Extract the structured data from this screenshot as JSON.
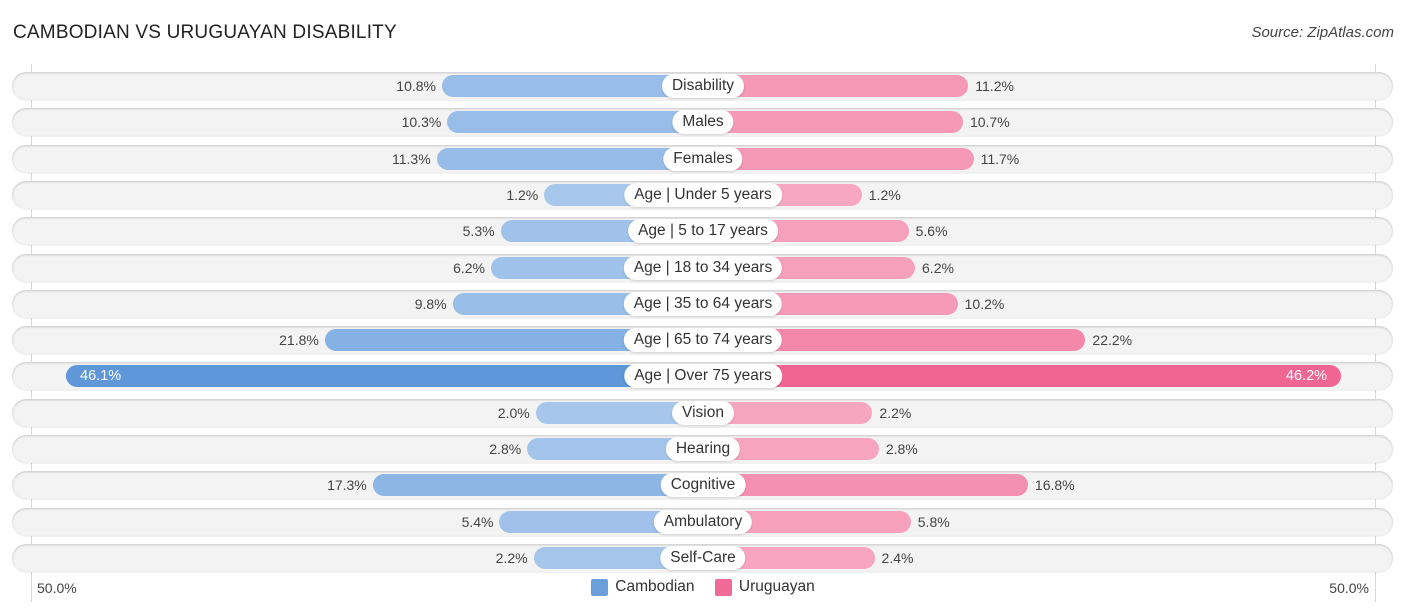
{
  "header": {
    "title": "CAMBODIAN VS URUGUAYAN DISABILITY",
    "source": "Source: ZipAtlas.com"
  },
  "axis": {
    "left_label": "50.0%",
    "right_label": "50.0%"
  },
  "legend": {
    "items": [
      {
        "label": "Cambodian",
        "color": "#6a9fdc"
      },
      {
        "label": "Uruguayan",
        "color": "#f06a96"
      }
    ]
  },
  "colors": {
    "left_light": "#a9c8ec",
    "left_dark": "#5e98da",
    "right_light": "#f7a9c2",
    "right_dark": "#f06592"
  },
  "chart_data": {
    "type": "bar",
    "orientation": "horizontal-diverging",
    "title": "CAMBODIAN VS URUGUAYAN DISABILITY",
    "xlim": [
      0,
      50
    ],
    "unit": "%",
    "categories": [
      "Disability",
      "Males",
      "Females",
      "Age | Under 5 years",
      "Age | 5 to 17 years",
      "Age | 18 to 34 years",
      "Age | 35 to 64 years",
      "Age | 65 to 74 years",
      "Age | Over 75 years",
      "Vision",
      "Hearing",
      "Cognitive",
      "Ambulatory",
      "Self-Care"
    ],
    "series": [
      {
        "name": "Cambodian",
        "side": "left",
        "values": [
          10.8,
          10.3,
          11.3,
          1.2,
          5.3,
          6.2,
          9.8,
          21.8,
          46.1,
          2.0,
          2.8,
          17.3,
          5.4,
          2.2
        ],
        "labels": [
          "10.8%",
          "10.3%",
          "11.3%",
          "1.2%",
          "5.3%",
          "6.2%",
          "9.8%",
          "21.8%",
          "46.1%",
          "2.0%",
          "2.8%",
          "17.3%",
          "5.4%",
          "2.2%"
        ]
      },
      {
        "name": "Uruguayan",
        "side": "right",
        "values": [
          11.2,
          10.7,
          11.7,
          1.2,
          5.6,
          6.2,
          10.2,
          22.2,
          46.2,
          2.2,
          2.8,
          16.8,
          5.8,
          2.4
        ],
        "labels": [
          "11.2%",
          "10.7%",
          "11.7%",
          "1.2%",
          "5.6%",
          "6.2%",
          "10.2%",
          "22.2%",
          "46.2%",
          "2.2%",
          "2.8%",
          "16.8%",
          "5.8%",
          "2.4%"
        ]
      }
    ],
    "legend_position": "bottom-center"
  }
}
